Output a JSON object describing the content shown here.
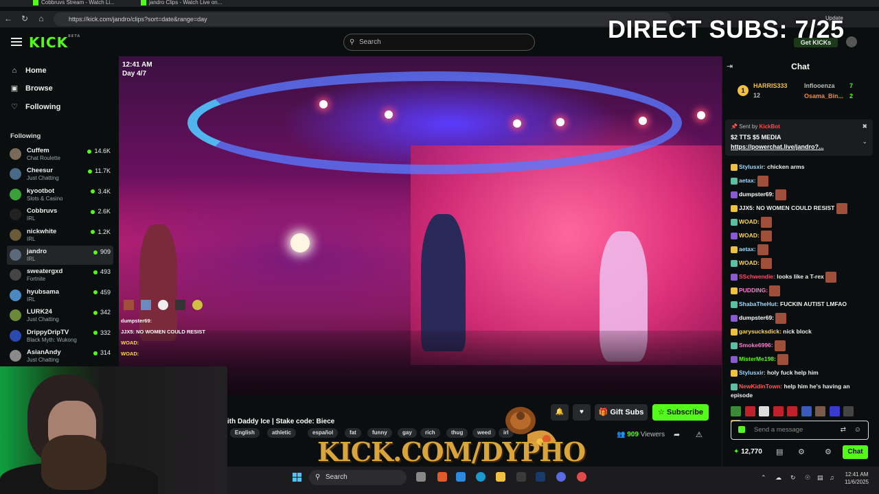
{
  "browser": {
    "tabs": [
      {
        "label": "Cobbruvs Stream - Watch Li..."
      },
      {
        "label": "jandro Clips - Watch Live on..."
      }
    ],
    "url": "https://kick.com/jandro/clips?sort=date&range=day",
    "update_label": "Update"
  },
  "header": {
    "logo": "KICK",
    "logo_sup": "BETA",
    "search_placeholder": "Search",
    "get_kicks": "Get KICKs"
  },
  "overlay": {
    "direct_subs": "DIRECT SUBS: 7/25",
    "brand_text": "KICK.COM/DYPHO"
  },
  "sidebar": {
    "nav": [
      {
        "label": "Home",
        "icon": "home-icon"
      },
      {
        "label": "Browse",
        "icon": "browse-icon"
      },
      {
        "label": "Following",
        "icon": "heart-icon"
      }
    ],
    "following_header": "Following",
    "channels": [
      {
        "name": "Cuffem",
        "category": "Chat Roulette",
        "viewers": "14.6K",
        "color": "#7a6a5a"
      },
      {
        "name": "Cheesur",
        "category": "Just Chatting",
        "viewers": "11.7K",
        "color": "#4a6a8a"
      },
      {
        "name": "kyootbot",
        "category": "Slots & Casino",
        "viewers": "3.4K",
        "color": "#3aa03a"
      },
      {
        "name": "Cobbruvs",
        "category": "IRL",
        "viewers": "2.6K",
        "color": "#222222"
      },
      {
        "name": "nickwhite",
        "category": "IRL",
        "viewers": "1.2K",
        "color": "#6a5a3a"
      },
      {
        "name": "jandro",
        "category": "IRL",
        "viewers": "909",
        "color": "#5a6a7a"
      },
      {
        "name": "sweatergxd",
        "category": "Fortnite",
        "viewers": "493",
        "color": "#444444"
      },
      {
        "name": "hyubsama",
        "category": "IRL",
        "viewers": "459",
        "color": "#4a8ac0"
      },
      {
        "name": "LURK24",
        "category": "Just Chatting",
        "viewers": "342",
        "color": "#6a8a3a"
      },
      {
        "name": "DrippyDripTV",
        "category": "Black Myth: Wukong",
        "viewers": "332",
        "color": "#2a4ab0"
      },
      {
        "name": "AsianAndy",
        "category": "Just Chatting",
        "viewers": "314",
        "color": "#8a8a8a"
      }
    ],
    "active_channel": "jandro"
  },
  "video": {
    "time": "12:41 AM",
    "day": "Day 4/7",
    "chat_overlay": [
      {
        "user": "dumpster69:",
        "text": ""
      },
      {
        "user": "JJX5:",
        "text": "NO WOMEN COULD RESIST"
      },
      {
        "user": "WOAD:",
        "text": ""
      },
      {
        "user": "WOAD:",
        "text": ""
      }
    ]
  },
  "stream": {
    "title": "ith Daddy Ice | Stake code: Biece",
    "tags": [
      "English",
      "athletic",
      "español",
      "fat",
      "funny",
      "gay",
      "rich",
      "thug",
      "weed",
      "irl"
    ],
    "gift_subs": "Gift Subs",
    "subscribe": "Subscribe",
    "viewers_count": "909",
    "viewers_label": "Viewers"
  },
  "chat": {
    "title": "Chat",
    "leaderboard": [
      {
        "rank": "1",
        "name": "HARRIS333",
        "count": "12"
      },
      {
        "name": "Inflooenza",
        "count": "7"
      },
      {
        "name": "Osama_Bin...",
        "count": "2"
      }
    ],
    "pinned": {
      "sent_by_label": "Sent by",
      "sender": "KickBot",
      "line1": "$2 TTS $5 MEDIA",
      "link": "https://powerchat.live/jandro?..."
    },
    "messages": [
      {
        "user": "Stylusxir:",
        "text": "chicken arms",
        "color": "#a0d8ff",
        "emote": false
      },
      {
        "user": "aetax:",
        "text": "",
        "color": "#a0d8ff",
        "emote": true
      },
      {
        "user": "dumpster69:",
        "text": "",
        "color": "#ffffff",
        "emote": true
      },
      {
        "user": "JJX5:",
        "text": "NO WOMEN COULD RESIST",
        "color": "#ffffff",
        "emote": true
      },
      {
        "user": "WOAD:",
        "text": "",
        "color": "#ffd84a",
        "emote": true
      },
      {
        "user": "WOAD:",
        "text": "",
        "color": "#ffd84a",
        "emote": true
      },
      {
        "user": "aetax:",
        "text": "",
        "color": "#a0d8ff",
        "emote": true
      },
      {
        "user": "WOAD:",
        "text": "",
        "color": "#ffd84a",
        "emote": true
      },
      {
        "user": "SSchwendie:",
        "text": "looks like a T-rex",
        "color": "#ff4a6a",
        "emote": true
      },
      {
        "user": "PUDDING:",
        "text": "",
        "color": "#ff7ad0",
        "emote": true
      },
      {
        "user": "ShabaTheHut:",
        "text": "FUCKIN AUTIST LMFAO",
        "color": "#a0d8ff",
        "emote": false
      },
      {
        "user": "dumpster69:",
        "text": "",
        "color": "#ffffff",
        "emote": true
      },
      {
        "user": "garysucksdick:",
        "text": "nick block",
        "color": "#ffd84a",
        "emote": false
      },
      {
        "user": "Smoke6996:",
        "text": "",
        "color": "#ff7ad0",
        "emote": true
      },
      {
        "user": "MisterMe198:",
        "text": "",
        "color": "#53fc18",
        "emote": true
      },
      {
        "user": "Stylusxir:",
        "text": "holy fuck help him",
        "color": "#a0d8ff",
        "emote": false
      },
      {
        "user": "NewKidinTown:",
        "text": "help him he's having an",
        "color": "#ff5a5a",
        "emote": false
      },
      {
        "user": "",
        "text": "episode",
        "color": "#ffffff",
        "emote": false
      }
    ],
    "input_placeholder": "Send a message",
    "kicks_balance": "12,770",
    "send_label": "Chat"
  },
  "taskbar": {
    "search_label": "Search",
    "time": "12:41 AM",
    "date": "11/6/2025"
  }
}
